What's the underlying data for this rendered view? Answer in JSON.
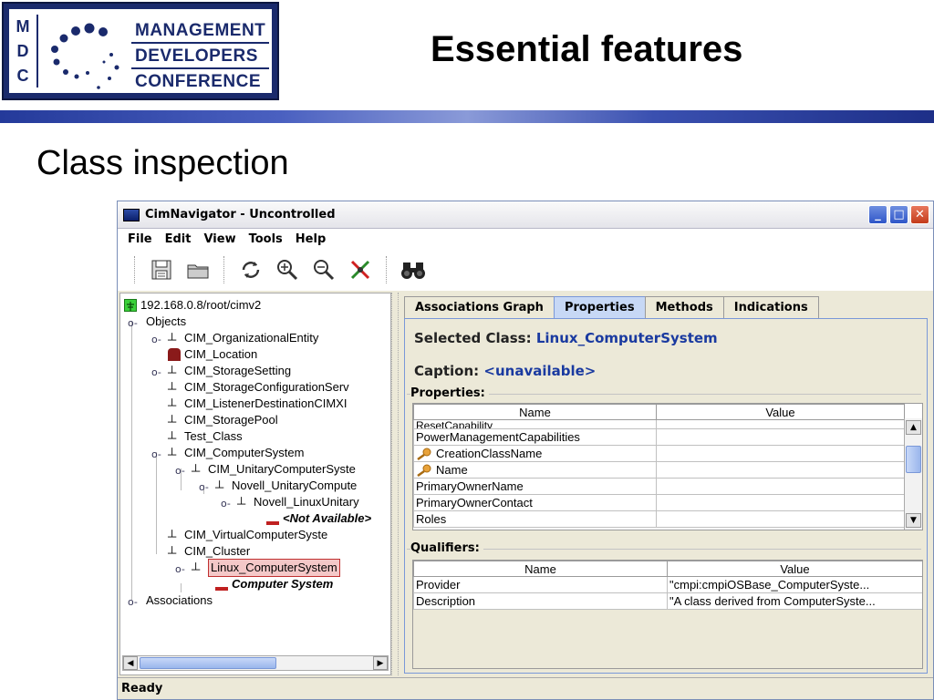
{
  "slide": {
    "title": "Essential features",
    "subtitle": "Class inspection",
    "logo": {
      "letters": [
        "M",
        "D",
        "C"
      ],
      "words": [
        "MANAGEMENT",
        "DEVELOPERS",
        "CONFERENCE"
      ]
    },
    "colors": {
      "brand": "#1a2a6c",
      "banner": "#3a50b0"
    }
  },
  "window": {
    "title": "CimNavigator - Uncontrolled",
    "menu": [
      "File",
      "Edit",
      "View",
      "Tools",
      "Help"
    ],
    "toolbar_icons": [
      "save-icon",
      "open-folder-icon",
      "refresh-icon",
      "zoom-in-icon",
      "zoom-out-icon",
      "disconnect-icon",
      "find-icon"
    ],
    "status": "Ready"
  },
  "tree": {
    "root": "192.168.0.8/root/cimv2",
    "nodes": [
      {
        "label": "Objects"
      },
      {
        "label": "CIM_OrganizationalEntity"
      },
      {
        "label": "CIM_Location"
      },
      {
        "label": "CIM_StorageSetting"
      },
      {
        "label": "CIM_StorageConfigurationServ"
      },
      {
        "label": "CIM_ListenerDestinationCIMXI"
      },
      {
        "label": "CIM_StoragePool"
      },
      {
        "label": "Test_Class"
      },
      {
        "label": "CIM_ComputerSystem"
      },
      {
        "label": "CIM_UnitaryComputerSyste"
      },
      {
        "label": "Novell_UnitaryCompute"
      },
      {
        "label": "Novell_LinuxUnitary"
      },
      {
        "label": "<Not Available>"
      },
      {
        "label": "CIM_VirtualComputerSyste"
      },
      {
        "label": "CIM_Cluster"
      },
      {
        "label": "Linux_ComputerSystem"
      },
      {
        "label": "Computer System"
      },
      {
        "label": "Associations"
      }
    ]
  },
  "tabs": [
    {
      "label": "Associations Graph"
    },
    {
      "label": "Properties"
    },
    {
      "label": "Methods"
    },
    {
      "label": "Indications"
    }
  ],
  "details": {
    "selected_class_label": "Selected Class:",
    "selected_class_value": "Linux_ComputerSystem",
    "caption_label": "Caption:",
    "caption_value": "<unavailable>",
    "properties_title": "Properties:",
    "qualifiers_title": "Qualifiers:"
  },
  "properties": {
    "headers": [
      "Name",
      "Value"
    ],
    "rows": [
      {
        "name": "ResetCapability",
        "value": ""
      },
      {
        "name": "PowerManagementCapabilities",
        "value": ""
      },
      {
        "name": "CreationClassName",
        "value": ""
      },
      {
        "name": "Name",
        "value": ""
      },
      {
        "name": "PrimaryOwnerName",
        "value": ""
      },
      {
        "name": "PrimaryOwnerContact",
        "value": ""
      },
      {
        "name": "Roles",
        "value": ""
      }
    ]
  },
  "qualifiers": {
    "headers": [
      "Name",
      "Value"
    ],
    "rows": [
      {
        "name": "Provider",
        "value": "\"cmpi:cmpiOSBase_ComputerSyste..."
      },
      {
        "name": "Description",
        "value": "\"A class derived from ComputerSyste..."
      }
    ]
  }
}
